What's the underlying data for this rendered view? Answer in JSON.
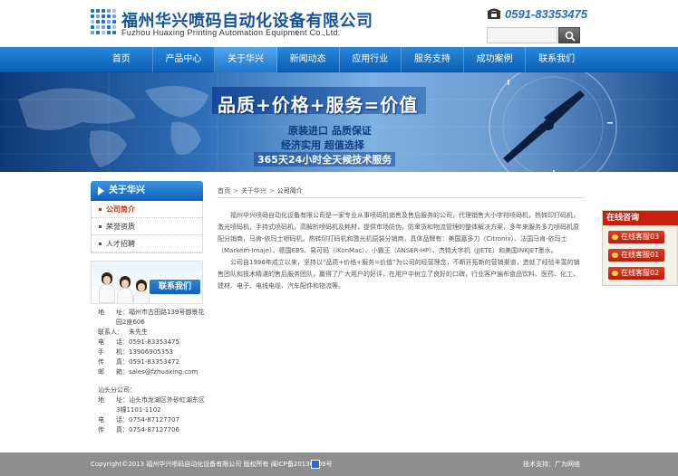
{
  "header": {
    "company_cn": "福州华兴喷码自动化设备有限公司",
    "company_en": "Fuzhou Huaxing Printing Automation Equipment Co.,Ltd.",
    "phone": "0591-83353475",
    "search_placeholder": ""
  },
  "nav": {
    "items": [
      {
        "label": "首页"
      },
      {
        "label": "产品中心"
      },
      {
        "label": "关于华兴"
      },
      {
        "label": "新闻动态"
      },
      {
        "label": "应用行业"
      },
      {
        "label": "服务支持"
      },
      {
        "label": "成功案例"
      },
      {
        "label": "联系我们"
      }
    ],
    "active_index": 2
  },
  "banner": {
    "slogan": "品质+价格+服务=价值",
    "line1": "原装进口 品质保证",
    "line2": "经济实用 超值选择",
    "line3": "365天24小时全天候技术服务"
  },
  "sidebar": {
    "title": "关于华兴",
    "items": [
      {
        "label": "公司简介",
        "active": true
      },
      {
        "label": "荣誉资质",
        "active": false
      },
      {
        "label": "人才招聘",
        "active": false
      }
    ],
    "contact_banner": "联系我们"
  },
  "contact": {
    "fuzhou": [
      {
        "k": "地",
        "v": "址：福州市古田路139号御景花园2座606"
      },
      {
        "k": "联系人：",
        "v": "朱先生"
      },
      {
        "k": "电",
        "v": "话：0591-83353475"
      },
      {
        "k": "手",
        "v": "机：13906905353"
      },
      {
        "k": "传",
        "v": "真：0591-83353472"
      },
      {
        "k": "邮",
        "v": "箱：sales@fzhuaxing.com"
      }
    ],
    "shantou_title": "汕头分公司：",
    "shantou": [
      {
        "k": "地",
        "v": "址：汕头市龙湖区外砂虹湖东区3幢1101-1102"
      },
      {
        "k": "电",
        "v": "话：0754-87127707"
      },
      {
        "k": "传",
        "v": "真：0754-87127706"
      }
    ]
  },
  "breadcrumb": {
    "home": "首页",
    "parent": "关于华兴",
    "current": "公司简介",
    "sep": ">"
  },
  "content": {
    "p1": "福州华兴喷码自动化设备有限公司是一家专业从事喷码机销售及售后服务的公司，代理销售大小字符喷码机，热转印打码机，激光喷码机，手持式喷码机，高解析喷码机及耗材，提供市场防伪，防窜货和物流管理的整体解决方案，多年来服务多力喷码机原配分销商，马肯-依玛士喷码机，热转印打码机和激光机原装分销商，具体品牌有：美国嘉多力（Citronix）、法国马肯-依玛士（Markem-Imaje）、德国EBS、易可码（iKonMac）、小霸王（ANSER-HP）、杰特大字机（JJETE）和美国INKJET墨水。",
    "p2": "公司自1996年成立以来，坚持以“品质+价格+服务=价值”为公司的经营理念，不断开拓新的营销渠道，造就了经验丰富的销售团队和技术精湛的售后服务团队，赢得了广大用户的好评，在用户中树立了良好的口碑，行业客户遍布食品饮料、医药、化工、建材、电子、电线电缆、汽车配件和物流等。"
  },
  "service": {
    "title": "在线咨询",
    "qq": [
      "在线客服03",
      "在线客服01",
      "在线客服02"
    ]
  },
  "footer": {
    "copyright": "Copyright©2013 福州华兴喷码自动化设备有限公司 版权所有 闽ICP备20130809号",
    "tech": "技术支持：广为网络"
  },
  "colors": {
    "nav_blue": "#1a73c9",
    "accent_red": "#c81f10",
    "footer_gray": "#8e8e8e"
  }
}
